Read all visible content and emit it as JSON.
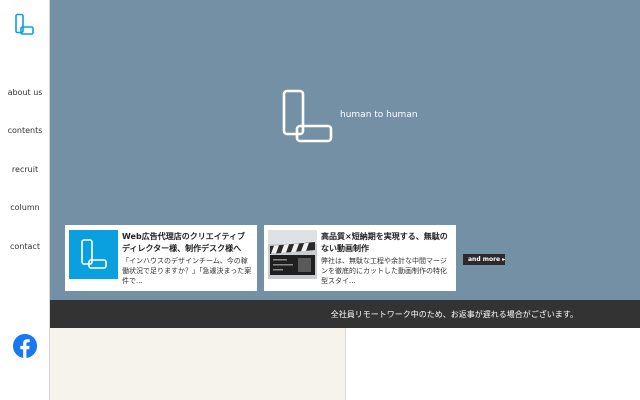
{
  "sidebar": {
    "logo_icon": "hth-logo-icon",
    "nav": [
      {
        "label": "about us"
      },
      {
        "label": "contents"
      },
      {
        "label": "recruit"
      },
      {
        "label": "column"
      },
      {
        "label": "contact"
      }
    ],
    "social_icon": "facebook-icon"
  },
  "hero": {
    "background_color": "#7490a5",
    "logo_icon": "hth-logo-icon",
    "tagline": "human to human",
    "cards": [
      {
        "thumb_icon": "hth-logo-icon",
        "thumb_color": "#0aa0e0",
        "title": "Web広告代理店のクリエイティブディレクター様、制作デスク様へ",
        "excerpt": "「インハウスのデザインチーム、今の稼働状況で足りますか？」「急遽決まった案件で..."
      },
      {
        "thumb_icon": "film-clapper-image",
        "title": "高品質×短納期を実現する、無駄のない動画制作",
        "excerpt": "弊社は、無駄な工程や余計な中間マージンを徹底的にカットした動画制作の特化型スタイ..."
      }
    ],
    "more_label": "and more ▸"
  },
  "notice": {
    "text": "全社員リモートワーク中のため、お返事が遅れる場合がございます。",
    "background_color": "#333333"
  },
  "lower": {
    "left_color": "#f6f2ec"
  }
}
